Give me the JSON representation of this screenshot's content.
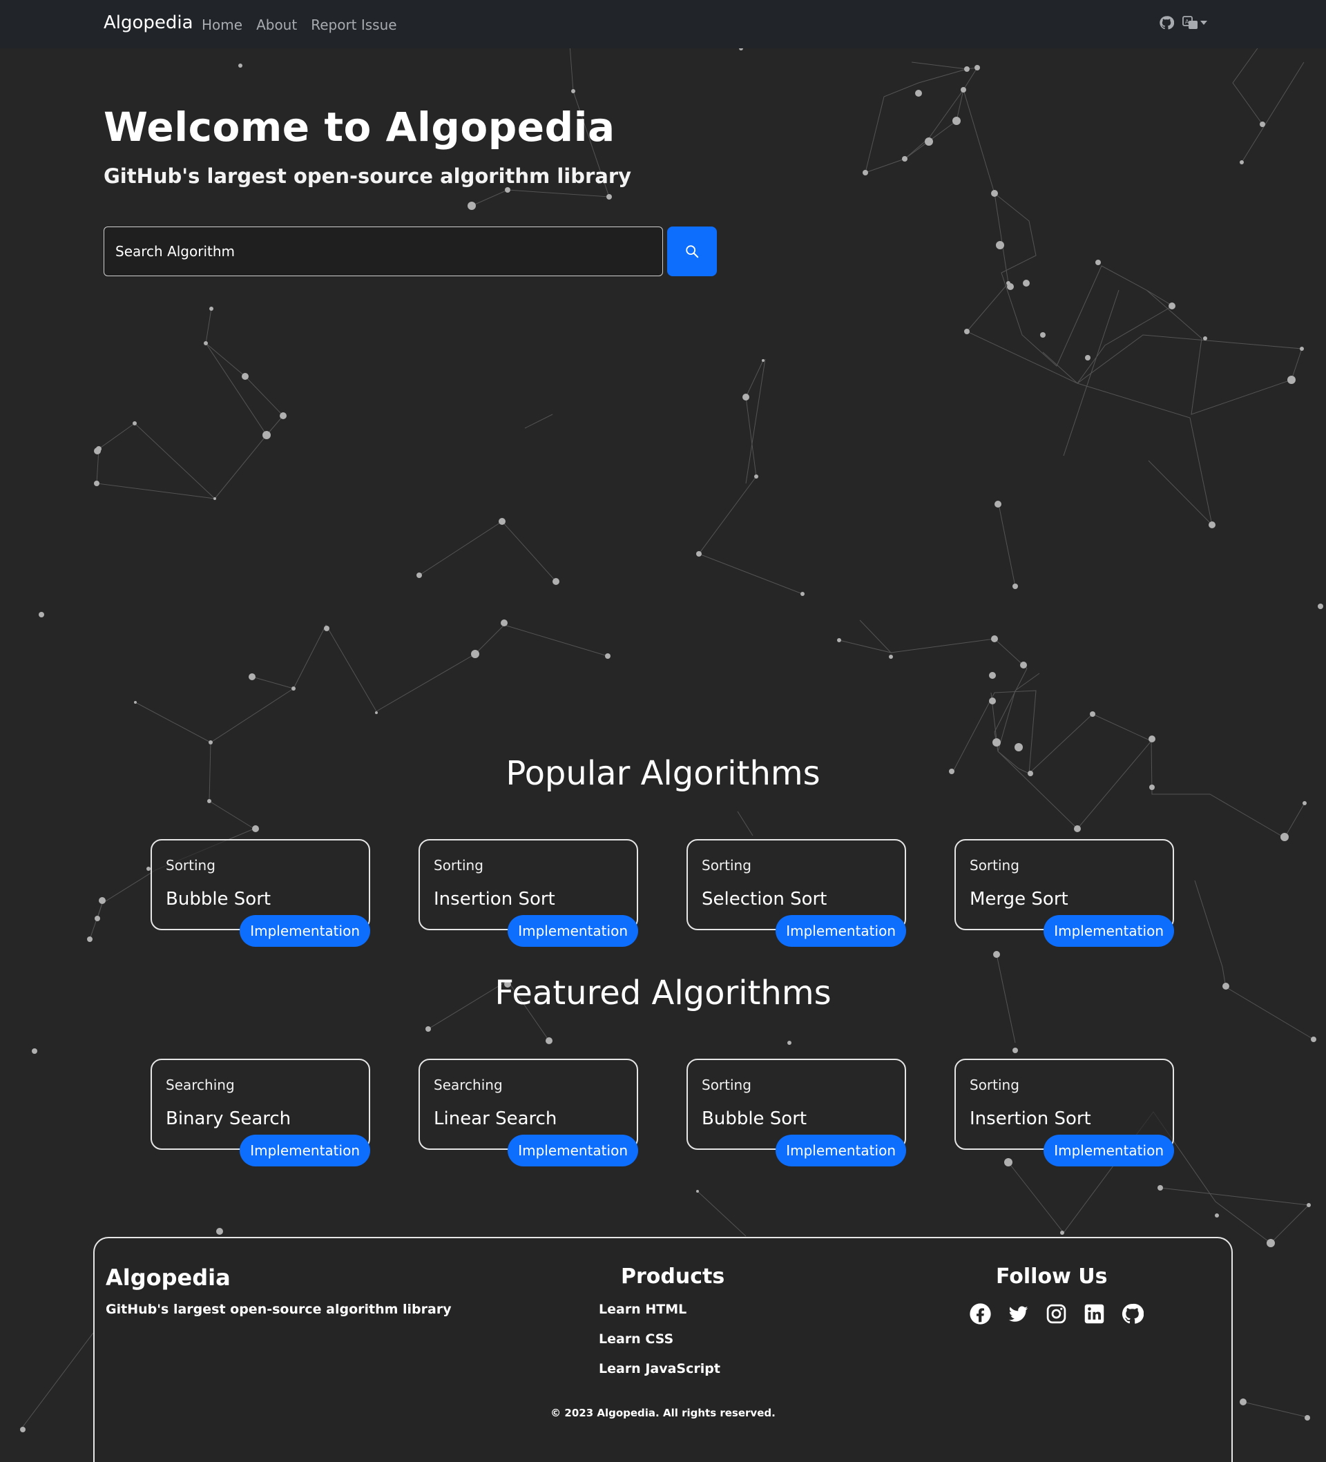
{
  "nav": {
    "brand": "Algopedia",
    "links": [
      "Home",
      "About",
      "Report Issue"
    ],
    "right_icons": [
      "github-icon",
      "translate-icon",
      "caret-down-icon"
    ]
  },
  "hero": {
    "title": "Welcome to Algopedia",
    "subtitle": "GitHub's largest open-source algorithm library"
  },
  "search": {
    "placeholder": "Search Algorithm",
    "button_icon": "search-icon"
  },
  "popular": {
    "title": "Popular Algorithms",
    "cards": [
      {
        "category": "Sorting",
        "name": "Bubble Sort",
        "button": "Implementation"
      },
      {
        "category": "Sorting",
        "name": "Insertion Sort",
        "button": "Implementation"
      },
      {
        "category": "Sorting",
        "name": "Selection Sort",
        "button": "Implementation"
      },
      {
        "category": "Sorting",
        "name": "Merge Sort",
        "button": "Implementation"
      }
    ]
  },
  "featured": {
    "title": "Featured Algorithms",
    "cards": [
      {
        "category": "Searching",
        "name": "Binary Search",
        "button": "Implementation"
      },
      {
        "category": "Searching",
        "name": "Linear Search",
        "button": "Implementation"
      },
      {
        "category": "Sorting",
        "name": "Bubble Sort",
        "button": "Implementation"
      },
      {
        "category": "Sorting",
        "name": "Insertion Sort",
        "button": "Implementation"
      }
    ]
  },
  "footer": {
    "brand": "Algopedia",
    "tagline": "GitHub's largest open-source algorithm library",
    "products_title": "Products",
    "products": [
      "Learn HTML",
      "Learn CSS",
      "Learn JavaScript"
    ],
    "follow_title": "Follow Us",
    "social": [
      "facebook-icon",
      "twitter-icon",
      "instagram-icon",
      "linkedin-icon",
      "github-icon"
    ],
    "copyright": "© 2023 Algopedia. All rights reserved."
  },
  "colors": {
    "background": "#262626",
    "navbar": "#212529",
    "accent": "#0d6efd",
    "nav_link": "#a8acb1"
  }
}
